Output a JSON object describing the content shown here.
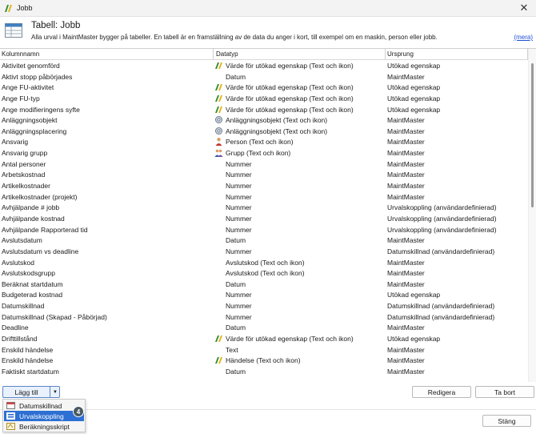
{
  "window": {
    "title": "Jobb",
    "close_glyph": "✕"
  },
  "header": {
    "title": "Tabell: Jobb",
    "description": "Alla urval i MaintMaster bygger på tabeller. En tabell är en framställning av de data du anger i kort, till exempel om en maskin, person eller jobb.",
    "more_link": "(mera)"
  },
  "columns": [
    "Kolumnnamn",
    "Datatyp",
    "Ursprung"
  ],
  "rows": [
    {
      "name": "Aktivitet genomförd",
      "type": "Värde för utökad egenskap (Text och ikon)",
      "icon": "pen-icon",
      "origin": "Utökad egenskap"
    },
    {
      "name": "Aktivt stopp påbörjades",
      "type": "Datum",
      "icon": "",
      "origin": "MaintMaster"
    },
    {
      "name": "Ange FU-aktivitet",
      "type": "Värde för utökad egenskap (Text och ikon)",
      "icon": "pen-icon",
      "origin": "Utökad egenskap"
    },
    {
      "name": "Ange FU-typ",
      "type": "Värde för utökad egenskap (Text och ikon)",
      "icon": "pen-icon",
      "origin": "Utökad egenskap"
    },
    {
      "name": "Ange modifieringens syfte",
      "type": "Värde för utökad egenskap (Text och ikon)",
      "icon": "pen-icon",
      "origin": "Utökad egenskap"
    },
    {
      "name": "Anläggningsobjekt",
      "type": "Anläggningsobjekt (Text och ikon)",
      "icon": "gear-icon",
      "origin": "MaintMaster"
    },
    {
      "name": "Anläggningsplacering",
      "type": "Anläggningsobjekt (Text och ikon)",
      "icon": "gear-icon",
      "origin": "MaintMaster"
    },
    {
      "name": "Ansvarig",
      "type": "Person (Text och ikon)",
      "icon": "person-icon",
      "origin": "MaintMaster"
    },
    {
      "name": "Ansvarig grupp",
      "type": "Grupp (Text och ikon)",
      "icon": "group-icon",
      "origin": "MaintMaster"
    },
    {
      "name": "Antal personer",
      "type": "Nummer",
      "icon": "",
      "origin": "MaintMaster"
    },
    {
      "name": "Arbetskostnad",
      "type": "Nummer",
      "icon": "",
      "origin": "MaintMaster"
    },
    {
      "name": "Artikelkostnader",
      "type": "Nummer",
      "icon": "",
      "origin": "MaintMaster"
    },
    {
      "name": "Artikelkostnader (projekt)",
      "type": "Nummer",
      "icon": "",
      "origin": "MaintMaster"
    },
    {
      "name": "Avhjälpande # jobb",
      "type": "Nummer",
      "icon": "",
      "origin": "Urvalskoppling (användardefinierad)"
    },
    {
      "name": "Avhjälpande kostnad",
      "type": "Nummer",
      "icon": "",
      "origin": "Urvalskoppling (användardefinierad)"
    },
    {
      "name": "Avhjälpande Rapporterad tid",
      "type": "Nummer",
      "icon": "",
      "origin": "Urvalskoppling (användardefinierad)"
    },
    {
      "name": "Avslutsdatum",
      "type": "Datum",
      "icon": "",
      "origin": "MaintMaster"
    },
    {
      "name": "Avslutsdatum vs deadline",
      "type": "Nummer",
      "icon": "",
      "origin": "Datumskillnad (användardefinierad)"
    },
    {
      "name": "Avslutskod",
      "type": "Avslutskod (Text och ikon)",
      "icon": "",
      "origin": "MaintMaster"
    },
    {
      "name": "Avslutskodsgrupp",
      "type": "Avslutskod (Text och ikon)",
      "icon": "",
      "origin": "MaintMaster"
    },
    {
      "name": "Beräknat startdatum",
      "type": "Datum",
      "icon": "",
      "origin": "MaintMaster"
    },
    {
      "name": "Budgeterad kostnad",
      "type": "Nummer",
      "icon": "",
      "origin": "Utökad egenskap"
    },
    {
      "name": "Datumskillnad",
      "type": "Nummer",
      "icon": "",
      "origin": "Datumskillnad (användardefinierad)"
    },
    {
      "name": "Datumskillnad (Skapad - Påbörjad)",
      "type": "Nummer",
      "icon": "",
      "origin": "Datumskillnad (användardefinierad)"
    },
    {
      "name": "Deadline",
      "type": "Datum",
      "icon": "",
      "origin": "MaintMaster"
    },
    {
      "name": "Drifttillstånd",
      "type": "Värde för utökad egenskap (Text och ikon)",
      "icon": "pen-icon",
      "origin": "Utökad egenskap"
    },
    {
      "name": "Enskild händelse",
      "type": "Text",
      "icon": "",
      "origin": "MaintMaster"
    },
    {
      "name": "Enskild händelse",
      "type": "Händelse (Text och ikon)",
      "icon": "pen-icon",
      "origin": "MaintMaster"
    },
    {
      "name": "Faktiskt startdatum",
      "type": "Datum",
      "icon": "",
      "origin": "MaintMaster"
    },
    {
      "name": "",
      "type": "",
      "icon": "",
      "origin": ""
    }
  ],
  "footer": {
    "add_label": "Lägg till",
    "edit_label": "Redigera",
    "delete_label": "Ta bort",
    "close_label": "Stäng",
    "menu_items": [
      "Datumskillnad",
      "Urvalskoppling",
      "Beräkningsskript"
    ],
    "selected_index": 1,
    "badge": "4"
  }
}
